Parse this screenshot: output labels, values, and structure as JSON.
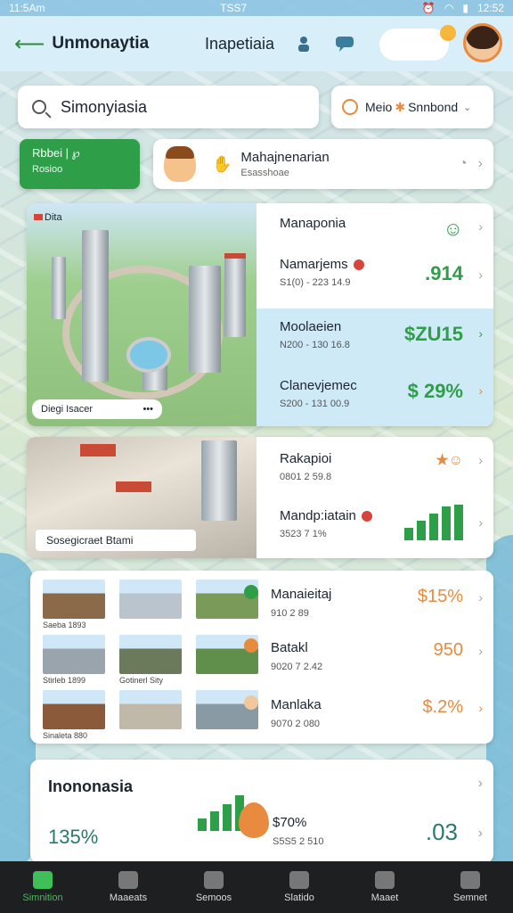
{
  "status_bar": {
    "time": "11:5Am",
    "center": "TSS7",
    "right": "12:52"
  },
  "header": {
    "title": "Unmonaytia",
    "subtitle": "Inapetiaia"
  },
  "search": {
    "value": "Simonyiasia"
  },
  "dropdown": {
    "label": "Meio",
    "sub": "Snnbond"
  },
  "green_button": {
    "line1": "Rbbei | ℘",
    "line2": "Rosioo"
  },
  "profile": {
    "title": "Mahajnenarian",
    "sub": "Esasshoae"
  },
  "listing": {
    "tag": "Dita",
    "image_caption": "Diegi Isacer",
    "caption_dots": "•••",
    "rows": [
      {
        "title": "Manaponia",
        "sub": "",
        "value": "☺"
      },
      {
        "title": "Namarjems",
        "sub": "S1(0) - 223 14.9",
        "value": ".914"
      },
      {
        "title": "Moolaeien",
        "sub": "N200 - 130 16.8",
        "value": "$ZU15"
      },
      {
        "title": "Clanevjemec",
        "sub": "S200 - 131 00.9",
        "value": "$ 29%"
      }
    ]
  },
  "street": {
    "image_caption": "Sosegicraet Btami",
    "rows": [
      {
        "title": "Rakapioi",
        "sub": "0801 2 59.8",
        "value": "★☺"
      },
      {
        "title": "Mandp:iatain",
        "sub": "3523 7 1%"
      }
    ],
    "bar_values": [
      14,
      22,
      30,
      38,
      40
    ]
  },
  "grid": {
    "thumbs": [
      {
        "caption": "Saeba 1893"
      },
      {
        "caption": ""
      },
      {
        "caption": ""
      },
      {
        "caption": "Stirleb 1899"
      },
      {
        "caption": "Gotinerl Sity"
      },
      {
        "caption": ""
      },
      {
        "caption": "Sinaleta 880"
      },
      {
        "caption": ""
      },
      {
        "caption": ""
      }
    ],
    "rows": [
      {
        "title": "Manaieitaj",
        "sub": "910 2 89",
        "value": "$15%"
      },
      {
        "title": "Batakl",
        "sub": "9020 7 2.42",
        "value": "950"
      },
      {
        "title": "Manlaka",
        "sub": "9070 2 080",
        "value": "$.2%"
      }
    ]
  },
  "summary": {
    "title": "Inononasia",
    "pct": "135%",
    "mid": "$70%",
    "mid_sub": "S5S5 2 510",
    "right_value": ".03",
    "bar_values": [
      14,
      22,
      30,
      40
    ]
  },
  "nav": [
    {
      "label": "Simnition",
      "active": true
    },
    {
      "label": "Maaeats",
      "active": false
    },
    {
      "label": "Semoos",
      "active": false
    },
    {
      "label": "Slatido",
      "active": false
    },
    {
      "label": "Maaet",
      "active": false
    },
    {
      "label": "Semnet",
      "active": false
    }
  ],
  "colors": {
    "accent": "#2f9e48",
    "orange": "#e88b3e",
    "highlight": "#cfeaf7"
  }
}
